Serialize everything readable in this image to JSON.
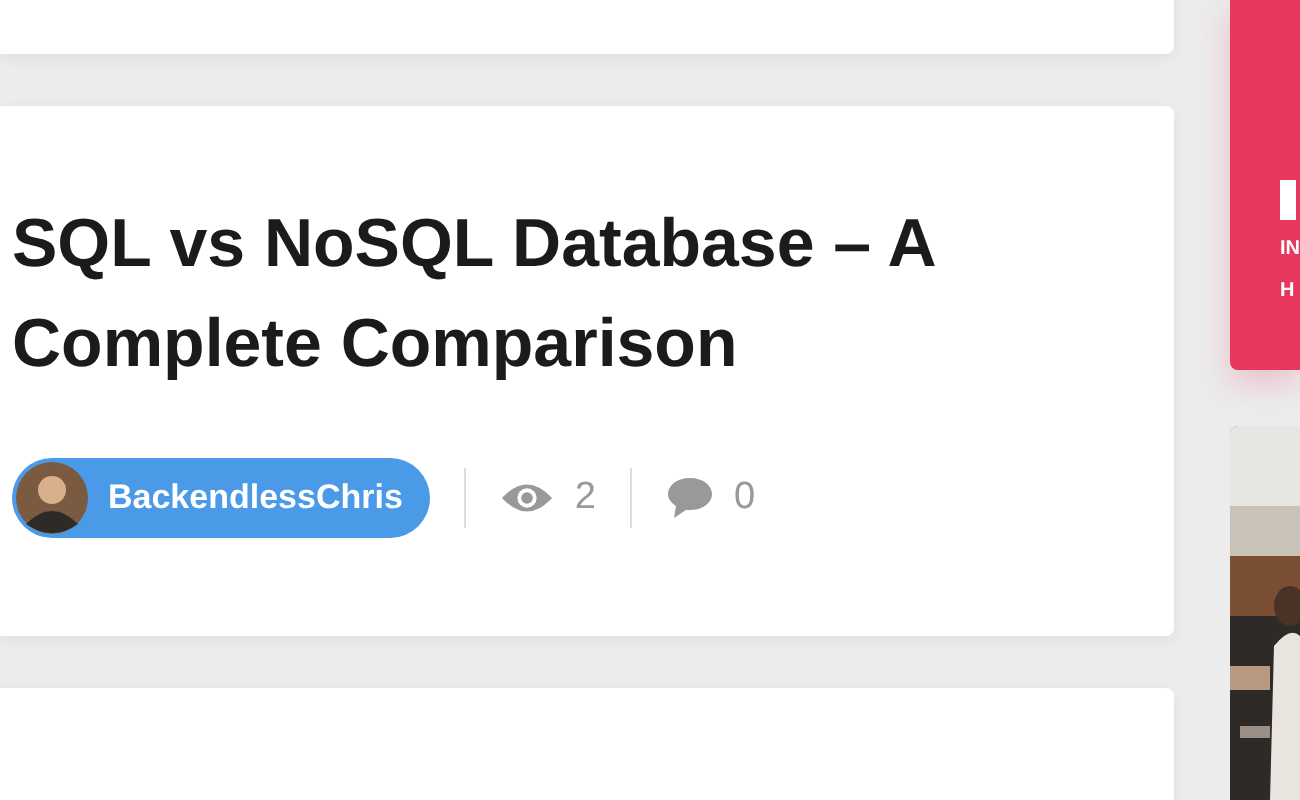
{
  "article": {
    "title": "SQL vs NoSQL Database – A Complete Comparison",
    "author": "BackendlessChris",
    "views": "2",
    "comments": "0"
  },
  "promo": {
    "lines": [
      "IN",
      "H"
    ]
  }
}
